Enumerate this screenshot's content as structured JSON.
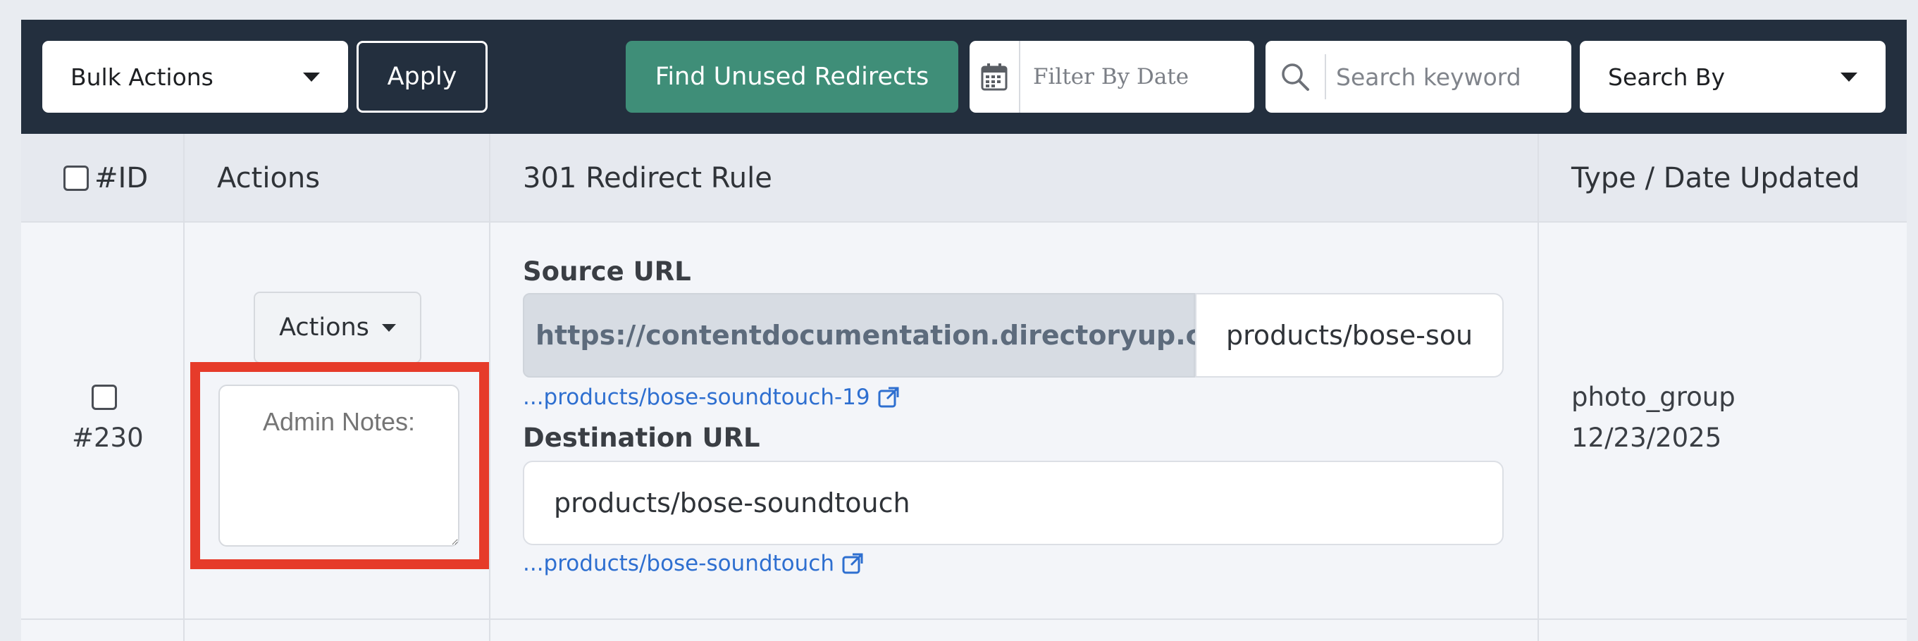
{
  "toolbar": {
    "bulk_actions_label": "Bulk Actions",
    "apply_label": "Apply",
    "find_unused_label": "Find Unused Redirects",
    "filter_date_placeholder": "Filter By Date",
    "search_placeholder": "Search keyword",
    "search_by_label": "Search By"
  },
  "table": {
    "headers": {
      "id": "#ID",
      "actions": "Actions",
      "rule": "301 Redirect Rule",
      "type_date": "Type / Date Updated"
    },
    "row": {
      "id": "#230",
      "actions_button": "Actions",
      "admin_notes_placeholder": "Admin Notes:",
      "source_label": "Source URL",
      "source_prefix": "https://contentdocumentation.directoryup.com/",
      "source_value": "products/bose-sou",
      "source_link": "...products/bose-soundtouch-19",
      "destination_label": "Destination URL",
      "destination_value": "products/bose-soundtouch",
      "destination_link": "...products/bose-soundtouch",
      "type": "photo_group",
      "date_updated": "12/23/2025"
    }
  },
  "colors": {
    "toolbar_bg": "#232f3e",
    "find_button": "#3f8e78",
    "highlight": "#e63b2a",
    "link": "#2e6fd0"
  }
}
